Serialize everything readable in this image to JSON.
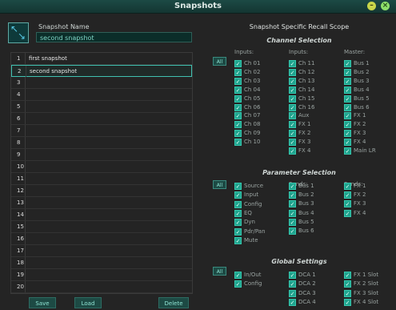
{
  "window": {
    "title": "Snapshots",
    "minimize_glyph": "–",
    "close_glyph": "×",
    "accent": "#1fa48e"
  },
  "snapshot_name": {
    "label": "Snapshot Name",
    "value": "second snapshot"
  },
  "snapshots": [
    {
      "num": "1",
      "name": "first snapshot"
    },
    {
      "num": "2",
      "name": "second snapshot",
      "selected": true
    },
    {
      "num": "3",
      "name": ""
    },
    {
      "num": "4",
      "name": ""
    },
    {
      "num": "5",
      "name": ""
    },
    {
      "num": "6",
      "name": ""
    },
    {
      "num": "7",
      "name": ""
    },
    {
      "num": "8",
      "name": ""
    },
    {
      "num": "9",
      "name": ""
    },
    {
      "num": "10",
      "name": ""
    },
    {
      "num": "11",
      "name": ""
    },
    {
      "num": "12",
      "name": ""
    },
    {
      "num": "13",
      "name": ""
    },
    {
      "num": "14",
      "name": ""
    },
    {
      "num": "15",
      "name": ""
    },
    {
      "num": "16",
      "name": ""
    },
    {
      "num": "17",
      "name": ""
    },
    {
      "num": "18",
      "name": ""
    },
    {
      "num": "19",
      "name": ""
    },
    {
      "num": "20",
      "name": ""
    }
  ],
  "buttons": {
    "save": "Save",
    "load": "Load",
    "delete": "Delete"
  },
  "scope": {
    "title": "Snapshot Specific Recall Scope",
    "all_label": "All",
    "channel": {
      "title": "Channel Selection",
      "columns": [
        {
          "header": "Inputs:",
          "items": [
            "Ch 01",
            "Ch 02",
            "Ch 03",
            "Ch 04",
            "Ch 05",
            "Ch 06",
            "Ch 07",
            "Ch 08",
            "Ch 09",
            "Ch 10"
          ]
        },
        {
          "header": "Inputs:",
          "items": [
            "Ch 11",
            "Ch 12",
            "Ch 13",
            "Ch 14",
            "Ch 15",
            "Ch 16",
            "Aux",
            "FX 1",
            "FX 2",
            "FX 3",
            "FX 4"
          ]
        },
        {
          "header": "Master:",
          "items": [
            "Bus 1",
            "Bus 2",
            "Bus 3",
            "Bus 4",
            "Bus 5",
            "Bus 6",
            "FX 1",
            "FX 2",
            "FX 3",
            "FX 4",
            "Main LR"
          ]
        }
      ]
    },
    "parameter": {
      "title": "Parameter Selection",
      "columns": [
        {
          "header": "",
          "items": [
            "Source",
            "Input",
            "Config",
            "EQ",
            "Dyn",
            "Pdr/Pan",
            "Mute"
          ]
        },
        {
          "header": "Sends:",
          "items": [
            "Bus 1",
            "Bus 2",
            "Bus 3",
            "Bus 4",
            "Bus 5",
            "Bus 6"
          ]
        },
        {
          "header": "Sends:",
          "items": [
            "FX 1",
            "FX 2",
            "FX 3",
            "FX 4"
          ]
        }
      ]
    },
    "global": {
      "title": "Global Settings",
      "columns": [
        {
          "header": "",
          "items": [
            "In/Out",
            "Config"
          ]
        },
        {
          "header": "",
          "items": [
            "DCA 1",
            "DCA 2",
            "DCA 3",
            "DCA 4"
          ]
        },
        {
          "header": "",
          "items": [
            "FX 1 Slot",
            "FX 2 Slot",
            "FX 3 Slot",
            "FX 4 Slot"
          ]
        }
      ]
    },
    "checked_glyph": "✓"
  }
}
